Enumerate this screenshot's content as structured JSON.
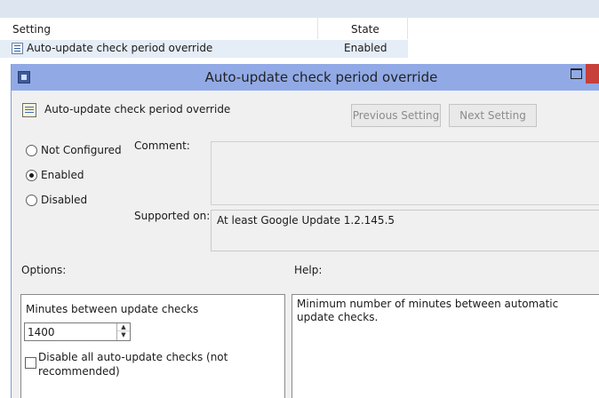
{
  "list": {
    "columns": [
      "Setting",
      "State"
    ],
    "rows": [
      {
        "name": "Auto-update check period override",
        "state": "Enabled"
      }
    ]
  },
  "dialog": {
    "title": "Auto-update check period override",
    "policy_name": "Auto-update check period override",
    "prev_button": "Previous Setting",
    "next_button": "Next Setting",
    "states": {
      "not_configured": "Not Configured",
      "enabled": "Enabled",
      "disabled": "Disabled",
      "selected": "Enabled"
    },
    "comment_label": "Comment:",
    "comment_value": "",
    "supported_label": "Supported on:",
    "supported_value": "At least Google Update 1.2.145.5",
    "options_label": "Options:",
    "help_label": "Help:",
    "options": {
      "minutes_label": "Minutes between update checks",
      "minutes_value": "1400",
      "disable_checkbox_label": "Disable all auto-update checks (not recommended)",
      "disable_checked": false
    },
    "help_text": "Minimum number of minutes between automatic update checks."
  },
  "icons": [
    "policy-list-icon",
    "dialog-app-icon",
    "maximize-icon",
    "close-icon",
    "policy-setting-icon"
  ],
  "colors": {
    "titlebar": "#91aae6",
    "close": "#c7403a",
    "row_selected": "#e5edf7"
  }
}
